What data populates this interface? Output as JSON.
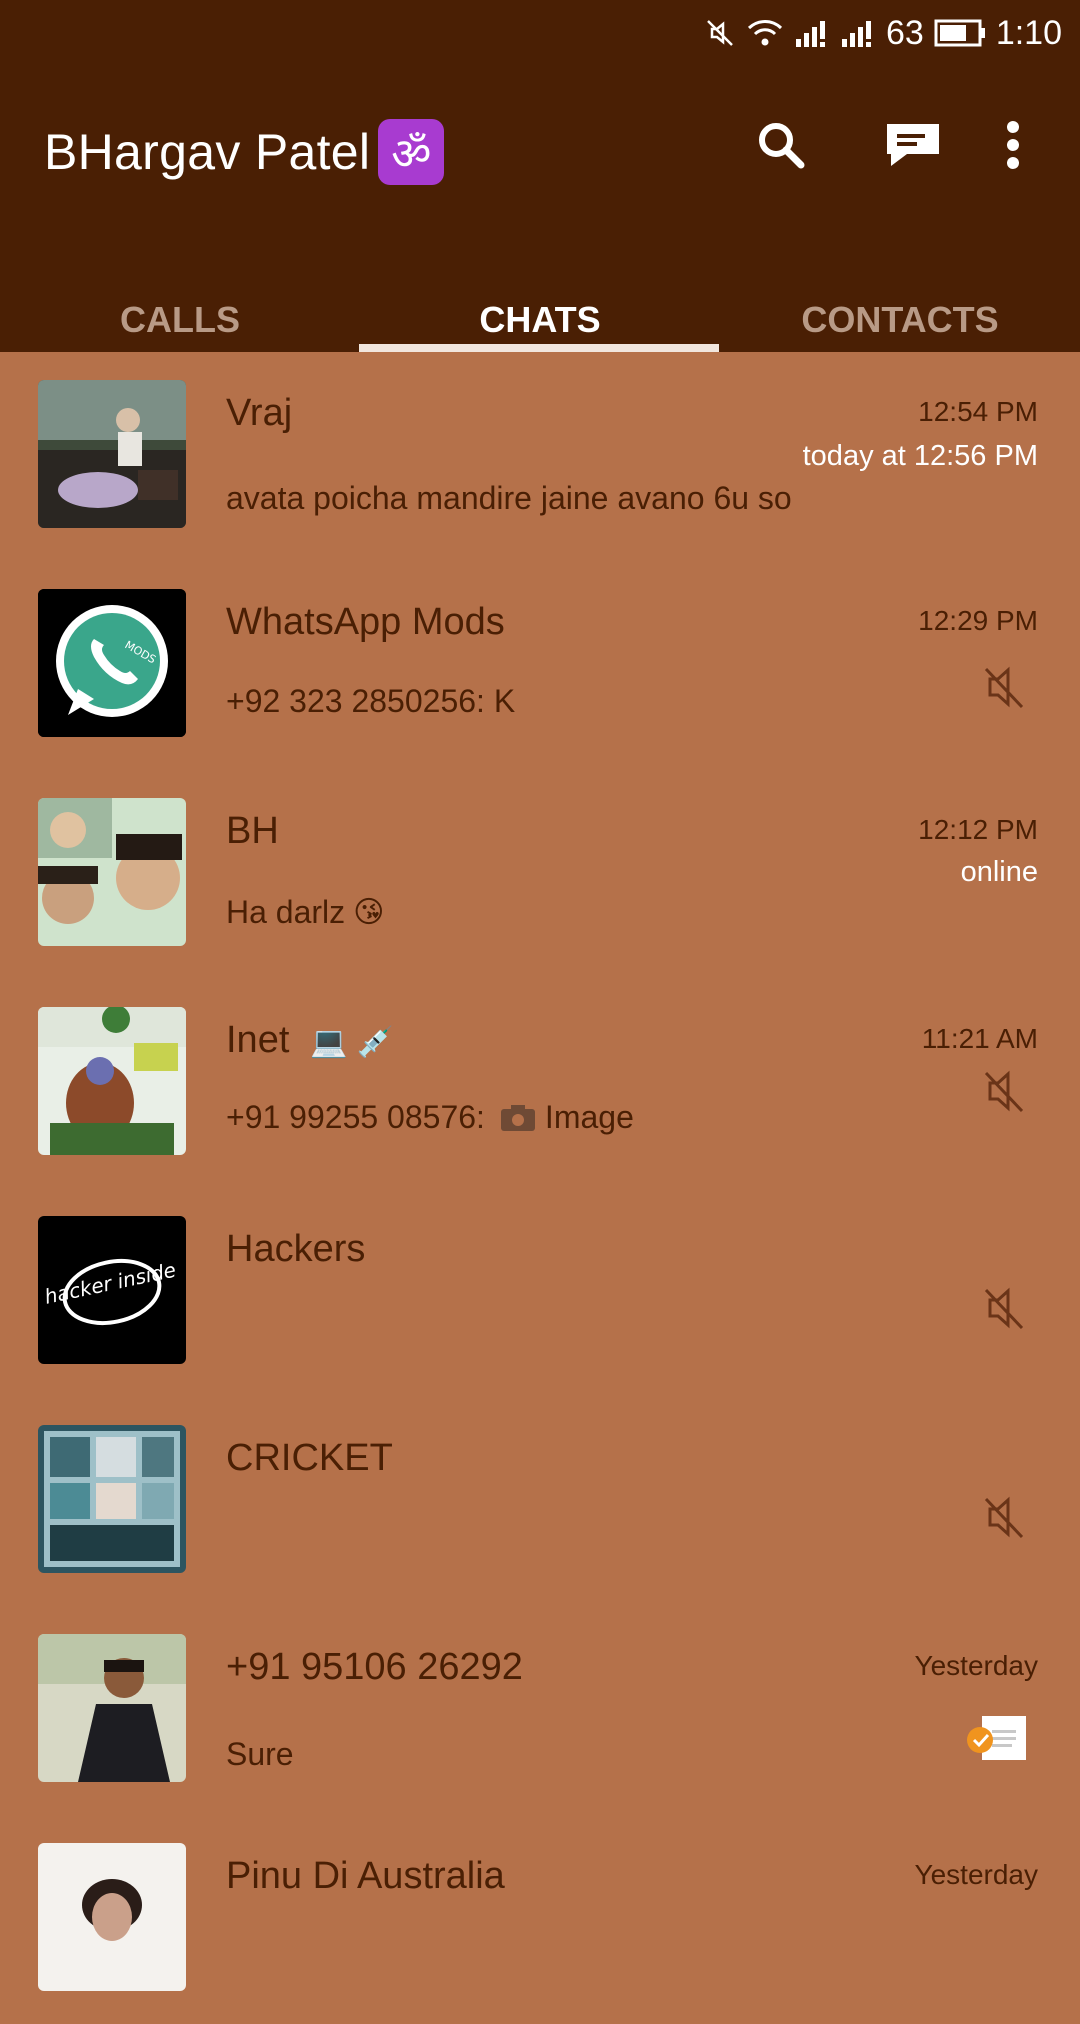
{
  "status_bar": {
    "battery_level": "63",
    "time": "1:10"
  },
  "app_bar": {
    "title": "BHargav Patel",
    "title_badge": "ॐ",
    "actions": [
      "search-icon",
      "new-chat-icon",
      "more-vert-icon"
    ]
  },
  "tabs": [
    {
      "label": "CALLS",
      "active": false
    },
    {
      "label": "CHATS",
      "active": true
    },
    {
      "label": "CONTACTS",
      "active": false
    }
  ],
  "chats": [
    {
      "name": "Vraj",
      "time": "12:54 PM",
      "status": "today at 12:56 PM",
      "message": "avata poicha mandire jaine avano 6u so",
      "muted": false
    },
    {
      "name": "WhatsApp Mods",
      "time": "12:29 PM",
      "status": "",
      "message": "+92 323 2850256: K",
      "muted": true
    },
    {
      "name": "BH",
      "time": "12:12 PM",
      "status": "online",
      "message": "Ha darlz",
      "message_emoji": "😘",
      "muted": false
    },
    {
      "name": "Inet",
      "name_emoji": "💻 💉",
      "time": "11:21 AM",
      "status": "",
      "message_prefix": "+91 99255 08576:",
      "message": "Image",
      "message_icon": "camera-icon",
      "muted": true
    },
    {
      "name": "Hackers",
      "time": "",
      "status": "",
      "message": "",
      "muted": true
    },
    {
      "name": "CRICKET",
      "time": "",
      "status": "",
      "message": "",
      "muted": true
    },
    {
      "name": "+91 95106 26292",
      "time": "Yesterday",
      "status": "",
      "message": "Sure",
      "muted": false,
      "badge": "delivered-tick-icon"
    },
    {
      "name": "Pinu Di Australia",
      "time": "Yesterday",
      "status": "",
      "message": "",
      "muted": false
    }
  ],
  "avatars": {
    "whatsapp_mods_logo_text": "MODS",
    "hackers_logo_text": "hacker inside"
  },
  "colors": {
    "toolbar": "#4a1f04",
    "background": "#b5714a",
    "text": "#4a1f04",
    "tab_inactive": "#b89a86",
    "tab_indicator": "#f1e6de"
  }
}
